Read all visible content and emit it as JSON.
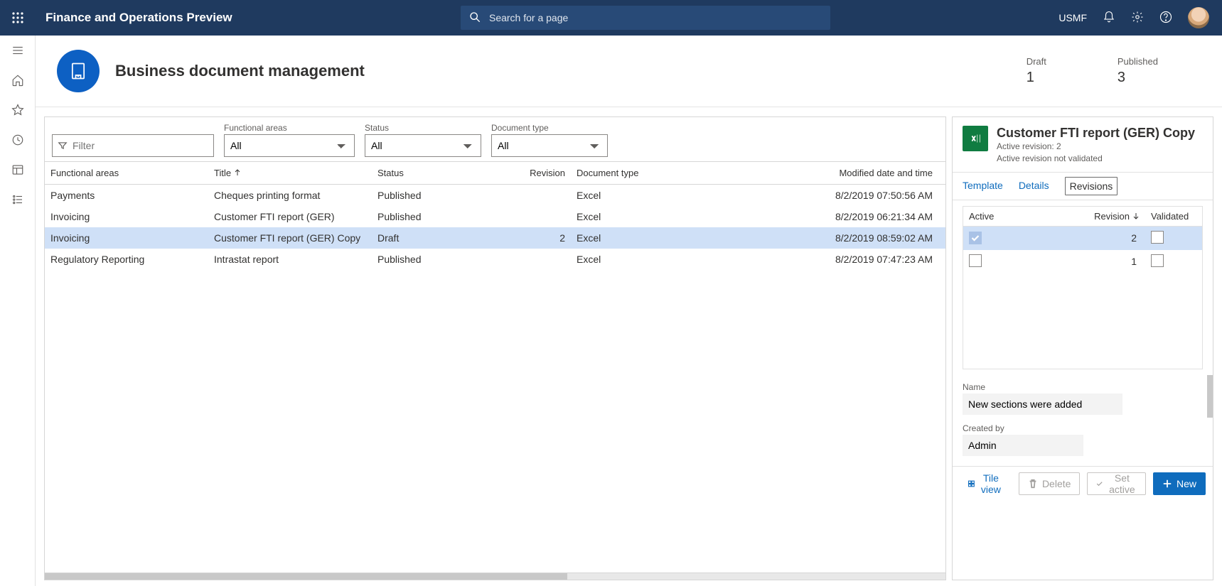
{
  "topbar": {
    "app_title": "Finance and Operations Preview",
    "search_placeholder": "Search for a page",
    "entity": "USMF"
  },
  "header": {
    "title": "Business document management",
    "metric_draft_label": "Draft",
    "metric_draft_value": "1",
    "metric_published_label": "Published",
    "metric_published_value": "3"
  },
  "filters": {
    "filter_placeholder": "Filter",
    "functional_areas_label": "Functional areas",
    "functional_areas_value": "All",
    "status_label": "Status",
    "status_value": "All",
    "document_type_label": "Document type",
    "document_type_value": "All"
  },
  "columns": {
    "functional_areas": "Functional areas",
    "title": "Title",
    "status": "Status",
    "revision": "Revision",
    "document_type": "Document type",
    "modified": "Modified date and time"
  },
  "rows": [
    {
      "fa": "Payments",
      "title": "Cheques printing format",
      "status": "Published",
      "rev": "",
      "doc": "Excel",
      "mod": "8/2/2019 07:50:56 AM"
    },
    {
      "fa": "Invoicing",
      "title": "Customer FTI report (GER)",
      "status": "Published",
      "rev": "",
      "doc": "Excel",
      "mod": "8/2/2019 06:21:34 AM"
    },
    {
      "fa": "Invoicing",
      "title": "Customer FTI report (GER) Copy",
      "status": "Draft",
      "rev": "2",
      "doc": "Excel",
      "mod": "8/2/2019 08:59:02 AM"
    },
    {
      "fa": "Regulatory Reporting",
      "title": "Intrastat report",
      "status": "Published",
      "rev": "",
      "doc": "Excel",
      "mod": "8/2/2019 07:47:23 AM"
    }
  ],
  "side": {
    "title": "Customer FTI report (GER) Copy",
    "sub1": "Active revision: 2",
    "sub2": "Active revision not validated",
    "tab_template": "Template",
    "tab_details": "Details",
    "tab_revisions": "Revisions",
    "rev_col_active": "Active",
    "rev_col_revision": "Revision",
    "rev_col_validated": "Validated",
    "revisions": [
      {
        "active": true,
        "rev": "2",
        "validated": false
      },
      {
        "active": false,
        "rev": "1",
        "validated": false
      }
    ],
    "name_label": "Name",
    "name_value": "New sections were added",
    "created_by_label": "Created by",
    "created_by_value": "Admin",
    "btn_tile": "Tile view",
    "btn_delete": "Delete",
    "btn_setactive": "Set active",
    "btn_new": "New"
  }
}
